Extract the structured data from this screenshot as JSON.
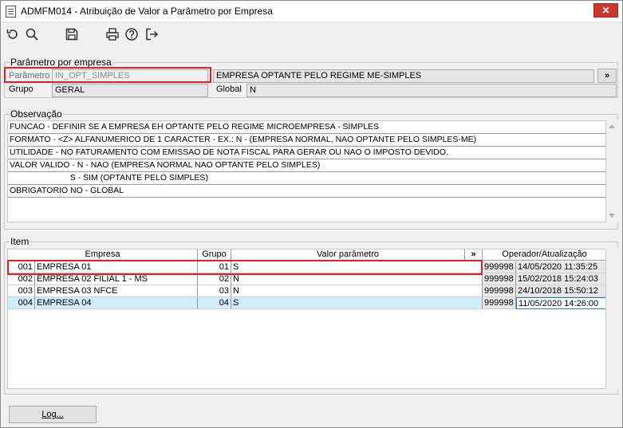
{
  "window": {
    "title": "ADMFM014 - Atribuição de Valor a Parâmetro por Empresa",
    "close_label": "✕"
  },
  "toolbar": {
    "icons": [
      "undo-icon",
      "search-icon",
      "save-icon",
      "print-icon",
      "help-icon",
      "exit-icon"
    ]
  },
  "parametro": {
    "legend": "Parâmetro por empresa",
    "parametro_label": "Parâmetro",
    "parametro_value": "IN_OPT_SIMPLES",
    "descricao_value": "EMPRESA OPTANTE PELO REGIME ME-SIMPLES",
    "more_label": "»",
    "grupo_label": "Grupo",
    "grupo_value": "GERAL",
    "global_label": "Global",
    "global_value": "N"
  },
  "observacao": {
    "legend": "Observação",
    "lines": [
      "FUNCAO - DEFINIR SE A EMPRESA  EH OPTANTE PELO REGIME MICROEMPRESA - SIMPLES",
      "FORMATO - <Z> ALFANUMERICO DE 1 CARACTER - EX.: N - (EMPRESA NORMAL, NAO OPTANTE PELO SIMPLES-ME)",
      "UTILIDADE - NO FATURAMENTO COM EMISSAO DE NOTA FISCAL PARA GERAR OU NAO O IMPOSTO DEVIDO.",
      "VALOR VALIDO - N - NAO (EMPRESA NORMAL NAO OPTANTE PELO SIMPLES)",
      "                          S - SIM (OPTANTE PELO SIMPLES)",
      "OBRIGATORIO NO - GLOBAL"
    ]
  },
  "item": {
    "legend": "Item",
    "headers": {
      "empresa": "Empresa",
      "grupo": "Grupo",
      "valor": "Valor parâmetro",
      "more": "»",
      "operador": "Operador/Atualização"
    },
    "rows": [
      {
        "codigo": "001",
        "empresa": "EMPRESA 01",
        "grupo": "01",
        "valor": "S",
        "operador": "999998",
        "data": "14/05/2020 11:35:25"
      },
      {
        "codigo": "002",
        "empresa": "EMPRESA 02 FILIAL 1 - MS",
        "grupo": "02",
        "valor": "N",
        "operador": "999998",
        "data": "15/02/2018 15:24:03"
      },
      {
        "codigo": "003",
        "empresa": "EMPRESA 03 NFCE",
        "grupo": "03",
        "valor": "N",
        "operador": "999998",
        "data": "24/10/2018 15:50:12"
      },
      {
        "codigo": "004",
        "empresa": "EMPRESA 04",
        "grupo": "04",
        "valor": "S",
        "operador": "999998",
        "data": "11/05/2020 14:26:00"
      }
    ]
  },
  "footer": {
    "log_label": "Log..."
  },
  "colors": {
    "highlight": "#e02020",
    "selected_row": "#cfeefb",
    "close_button": "#c8382f"
  }
}
